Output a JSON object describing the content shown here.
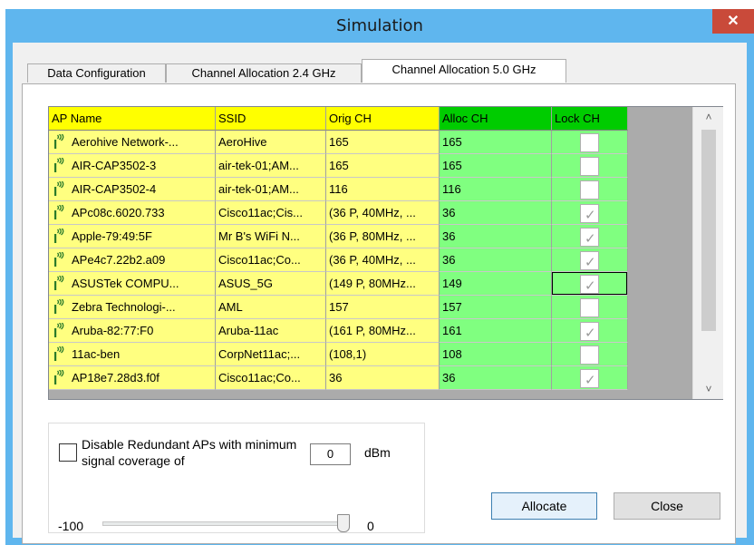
{
  "window": {
    "title": "Simulation",
    "close_glyph": "✕"
  },
  "tabs": [
    {
      "label": "Data Configuration",
      "active": false
    },
    {
      "label": "Channel Allocation 2.4 GHz",
      "active": false
    },
    {
      "label": "Channel Allocation 5.0 GHz",
      "active": true
    }
  ],
  "grid": {
    "columns": [
      "AP Name",
      "SSID",
      "Orig CH",
      "Alloc CH",
      "Lock CH"
    ],
    "rows": [
      {
        "name": "Aerohive Network-...",
        "ssid": "AeroHive",
        "orig": "165",
        "alloc": "165",
        "locked": false
      },
      {
        "name": "AIR-CAP3502-3",
        "ssid": "air-tek-01;AM...",
        "orig": "165",
        "alloc": "165",
        "locked": false
      },
      {
        "name": "AIR-CAP3502-4",
        "ssid": "air-tek-01;AM...",
        "orig": "116",
        "alloc": "116",
        "locked": false
      },
      {
        "name": "APc08c.6020.733",
        "ssid": "Cisco11ac;Cis...",
        "orig": "(36 P, 40MHz, ...",
        "alloc": "36",
        "locked": true
      },
      {
        "name": "Apple-79:49:5F",
        "ssid": "Mr B's WiFi N...",
        "orig": "(36 P, 80MHz, ...",
        "alloc": "36",
        "locked": true
      },
      {
        "name": "APe4c7.22b2.a09",
        "ssid": "Cisco11ac;Co...",
        "orig": "(36 P, 40MHz, ...",
        "alloc": "36",
        "locked": true
      },
      {
        "name": "ASUSTek COMPU...",
        "ssid": "ASUS_5G",
        "orig": "(149 P, 80MHz...",
        "alloc": "149",
        "locked": true,
        "focused": true
      },
      {
        "name": "Zebra Technologi-...",
        "ssid": "AML",
        "orig": "157",
        "alloc": "157",
        "locked": false
      },
      {
        "name": "Aruba-82:77:F0",
        "ssid": "Aruba-11ac",
        "orig": "(161 P, 80MHz...",
        "alloc": "161",
        "locked": true
      },
      {
        "name": "11ac-ben",
        "ssid": "CorpNet11ac;...",
        "orig": "(108,1)",
        "alloc": "108",
        "locked": false
      },
      {
        "name": "AP18e7.28d3.f0f",
        "ssid": "Cisco11ac;Co...",
        "orig": "36",
        "alloc": "36",
        "locked": true
      }
    ],
    "icon": "wifi-ap-icon",
    "colors": {
      "yellow": "#ffff80",
      "green": "#80ff80",
      "header_yellow": "#ffff00",
      "header_green": "#00cc00"
    },
    "scroll_up": "˄",
    "scroll_down": "˅"
  },
  "redundant": {
    "checkbox_label": "Disable Redundant APs with minimum signal coverage of",
    "checked": false,
    "dbm_value": "0",
    "dbm_unit": "dBm",
    "slider_min_label": "-100",
    "slider_value_label": "0",
    "slider_fraction": 1.0
  },
  "buttons": {
    "allocate": "Allocate",
    "close": "Close"
  }
}
